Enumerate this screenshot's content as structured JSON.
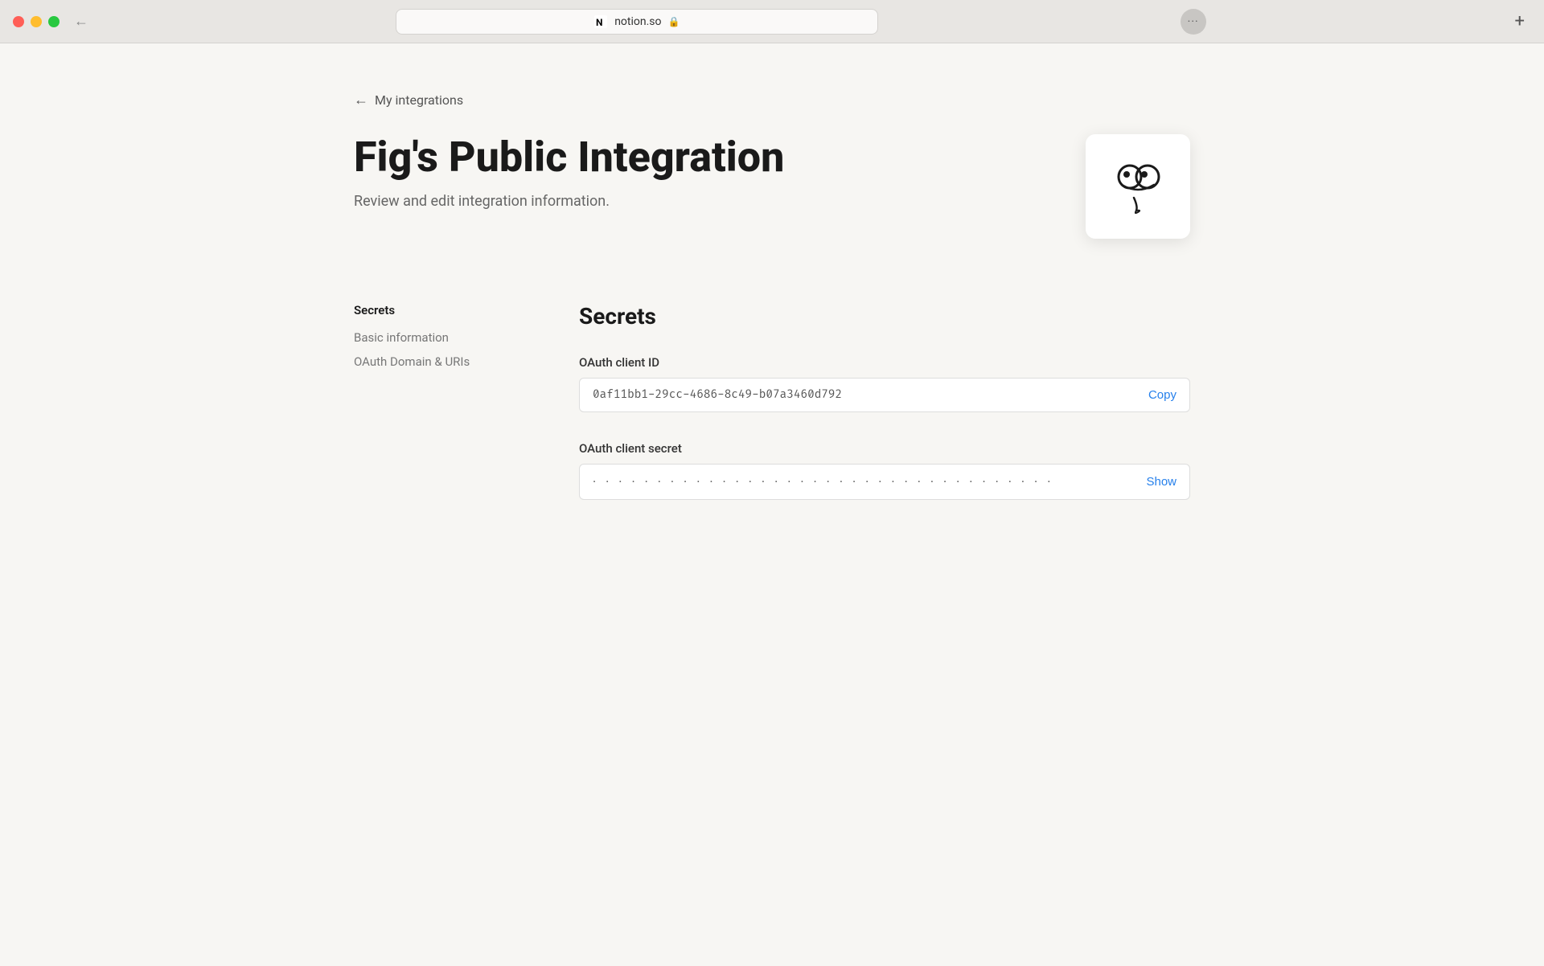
{
  "browser": {
    "url": "notion.so",
    "lock_symbol": "🔒",
    "notion_symbol": "N"
  },
  "nav": {
    "back_label": "My integrations",
    "back_arrow": "←"
  },
  "header": {
    "title": "Fig's Public Integration",
    "subtitle": "Review and edit integration information."
  },
  "sidebar": {
    "active_section": "Secrets",
    "items": [
      {
        "label": "Secrets",
        "active": true
      },
      {
        "label": "Basic information",
        "active": false
      },
      {
        "label": "OAuth Domain & URIs",
        "active": false
      }
    ]
  },
  "content": {
    "section_title": "Secrets",
    "oauth_client_id_label": "OAuth client ID",
    "oauth_client_id_value": "0af11bb1-29cc-4686-8c49-b07a3460d792",
    "copy_label": "Copy",
    "oauth_client_secret_label": "OAuth client secret",
    "oauth_client_secret_value": "••••••••••••••••••••••••••••••••••••••••",
    "show_label": "Show"
  },
  "icons": {
    "dots_menu": "···"
  }
}
